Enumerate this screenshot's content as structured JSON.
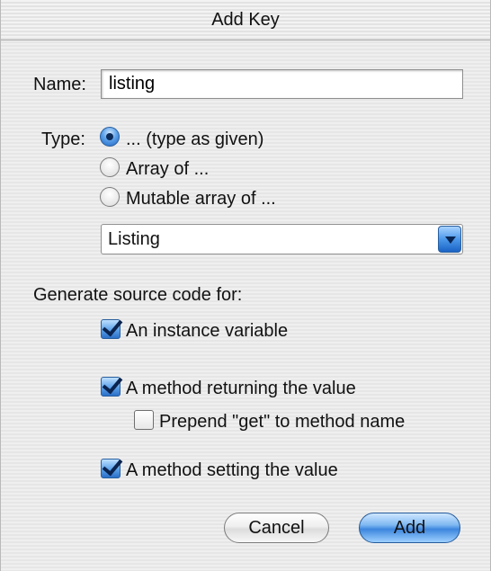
{
  "window": {
    "title": "Add Key"
  },
  "name_field": {
    "label": "Name:",
    "value": "listing"
  },
  "type_group": {
    "label": "Type:",
    "options": [
      {
        "label": "... (type as given)",
        "selected": true
      },
      {
        "label": "Array of ...",
        "selected": false
      },
      {
        "label": "Mutable array of ...",
        "selected": false
      }
    ]
  },
  "type_popup": {
    "selected": "Listing"
  },
  "generate": {
    "label": "Generate source code for:",
    "instance_variable": {
      "label": "An instance variable",
      "checked": true
    },
    "getter": {
      "label": "A method returning the value",
      "checked": true
    },
    "prepend_get": {
      "label": "Prepend \"get\" to method name",
      "checked": false
    },
    "setter": {
      "label": "A method setting the value",
      "checked": true
    }
  },
  "buttons": {
    "cancel": "Cancel",
    "add": "Add"
  },
  "colors": {
    "accent": "#3d86de",
    "window_bg": "#ececec"
  }
}
